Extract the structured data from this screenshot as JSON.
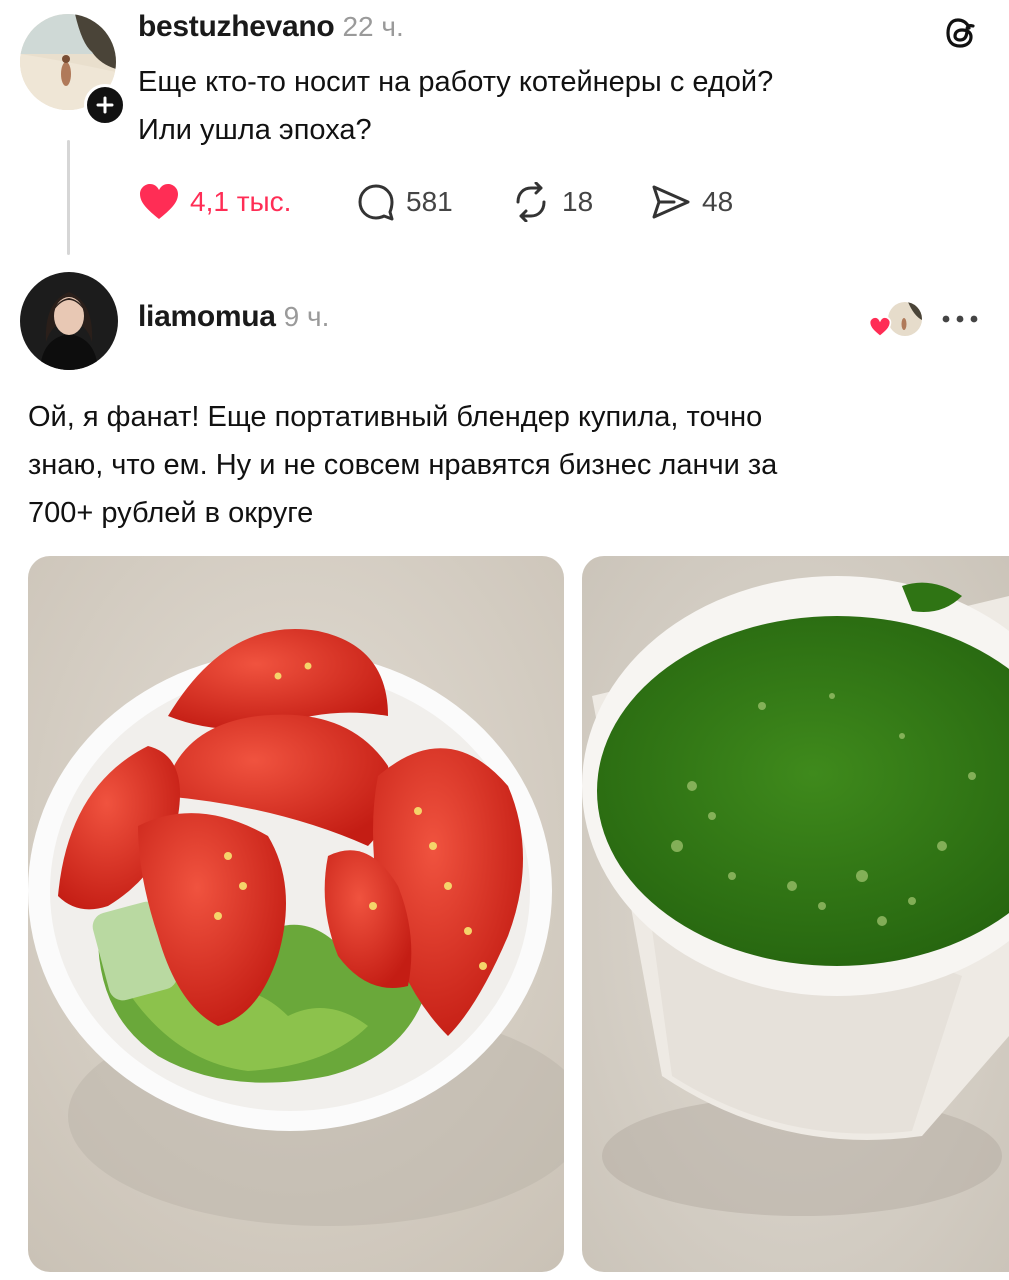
{
  "post": {
    "username": "bestuzhevano",
    "time": "22 ч.",
    "text_line1": "Еще кто-то носит на работу котейнеры с едой?",
    "text_line2": "Или ушла эпоха?",
    "likes": "4,1 тыс.",
    "replies": "581",
    "reposts": "18",
    "shares": "48"
  },
  "reply": {
    "username": "liamomua",
    "time": "9 ч.",
    "more_label": "···",
    "text_line1": "Ой, я фанат! Еще портативный блендер купила, точно",
    "text_line2": "знаю, что ем. Ну и не совсем нравятся бизнес ланчи за",
    "text_line3": "700+ рублей в округе",
    "images": [
      {
        "subject": "salad-bowl-tomatoes-lettuce"
      },
      {
        "subject": "green-smoothie-paper-cup"
      }
    ]
  },
  "colors": {
    "like_red": "#ff2d55",
    "text": "#111111",
    "muted": "#9a9a9a"
  },
  "icons": [
    "threads-logo-icon",
    "heart-icon",
    "comment-icon",
    "repost-icon",
    "share-icon",
    "plus-icon",
    "more-icon"
  ]
}
